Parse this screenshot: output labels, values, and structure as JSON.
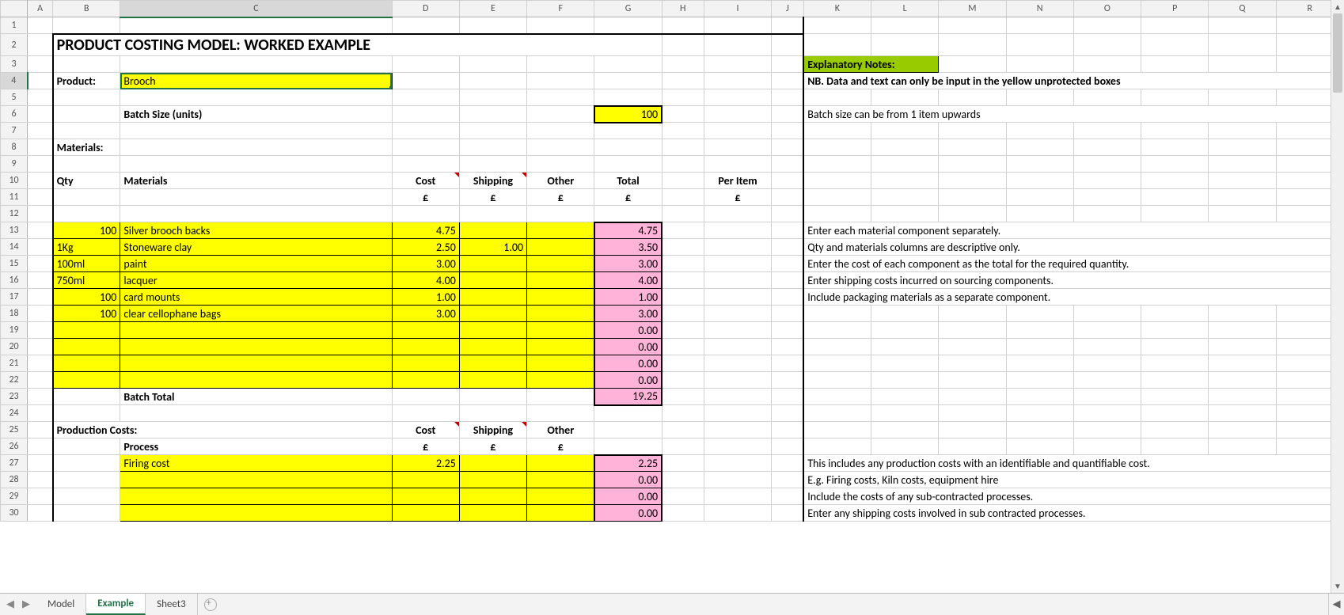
{
  "columns": [
    "A",
    "B",
    "C",
    "D",
    "E",
    "F",
    "G",
    "H",
    "I",
    "J",
    "K",
    "L",
    "M",
    "N",
    "O",
    "P",
    "Q",
    "R"
  ],
  "rows": [
    "1",
    "2",
    "3",
    "4",
    "5",
    "6",
    "7",
    "8",
    "9",
    "10",
    "11",
    "12",
    "13",
    "14",
    "15",
    "16",
    "17",
    "18",
    "19",
    "20",
    "21",
    "22",
    "23",
    "24",
    "25",
    "26",
    "27",
    "28",
    "29",
    "30"
  ],
  "title": "PRODUCT COSTING MODEL:   WORKED EXAMPLE",
  "labels": {
    "product": "Product:",
    "batch_size": "Batch Size (units)",
    "materials_hdr": "Materials:",
    "production_costs_hdr": "Production Costs:",
    "batch_total": "Batch Total",
    "explanatory_notes": "Explanatory Notes:"
  },
  "product_value": "Brooch",
  "batch_size_value": "100",
  "materials_columns": {
    "qty": "Qty",
    "materials": "Materials",
    "cost": "Cost",
    "shipping": "Shipping",
    "other": "Other",
    "total": "Total",
    "per_item": "Per Item",
    "currency": "£"
  },
  "materials": [
    {
      "qty": "100",
      "name": "Silver brooch backs",
      "cost": "4.75",
      "shipping": "",
      "other": "",
      "total": "4.75"
    },
    {
      "qty": "1Kg",
      "name": "Stoneware clay",
      "cost": "2.50",
      "shipping": "1.00",
      "other": "",
      "total": "3.50"
    },
    {
      "qty": "100ml",
      "name": "paint",
      "cost": "3.00",
      "shipping": "",
      "other": "",
      "total": "3.00"
    },
    {
      "qty": "750ml",
      "name": "lacquer",
      "cost": "4.00",
      "shipping": "",
      "other": "",
      "total": "4.00"
    },
    {
      "qty": "100",
      "name": "card mounts",
      "cost": "1.00",
      "shipping": "",
      "other": "",
      "total": "1.00"
    },
    {
      "qty": "100",
      "name": "clear cellophane bags",
      "cost": "3.00",
      "shipping": "",
      "other": "",
      "total": "3.00"
    },
    {
      "qty": "",
      "name": "",
      "cost": "",
      "shipping": "",
      "other": "",
      "total": "0.00"
    },
    {
      "qty": "",
      "name": "",
      "cost": "",
      "shipping": "",
      "other": "",
      "total": "0.00"
    },
    {
      "qty": "",
      "name": "",
      "cost": "",
      "shipping": "",
      "other": "",
      "total": "0.00"
    },
    {
      "qty": "",
      "name": "",
      "cost": "",
      "shipping": "",
      "other": "",
      "total": "0.00"
    }
  ],
  "batch_total_value": "19.25",
  "production_columns": {
    "process": "Process",
    "cost": "Cost",
    "shipping": "Shipping",
    "other": "Other",
    "currency": "£"
  },
  "production": [
    {
      "process": "Firing cost",
      "cost": "2.25",
      "shipping": "",
      "other": "",
      "total": "2.25"
    },
    {
      "process": "",
      "cost": "",
      "shipping": "",
      "other": "",
      "total": "0.00"
    },
    {
      "process": "",
      "cost": "",
      "shipping": "",
      "other": "",
      "total": "0.00"
    },
    {
      "process": "",
      "cost": "",
      "shipping": "",
      "other": "",
      "total": "0.00"
    }
  ],
  "notes": {
    "nb": "NB. Data and text can only be input in the yellow unprotected boxes",
    "batch": "Batch size can be from 1 item upwards",
    "mat1": "Enter each material component separately.",
    "mat2": "Qty and materials columns are descriptive only.",
    "mat3": "Enter the cost of each component as the total for the required quantity.",
    "mat4": "Enter shipping costs incurred on sourcing components.",
    "mat5": "Include packaging materials as a separate component.",
    "prod1": "This includes any production costs with an identifiable and quantifiable cost.",
    "prod2": "E.g.  Firing costs, Kiln costs, equipment hire",
    "prod3": "Include the costs of any sub-contracted processes.",
    "prod4": "Enter any shipping costs involved in sub contracted processes."
  },
  "tabs": [
    "Model",
    "Example",
    "Sheet3"
  ],
  "active_tab": 1
}
